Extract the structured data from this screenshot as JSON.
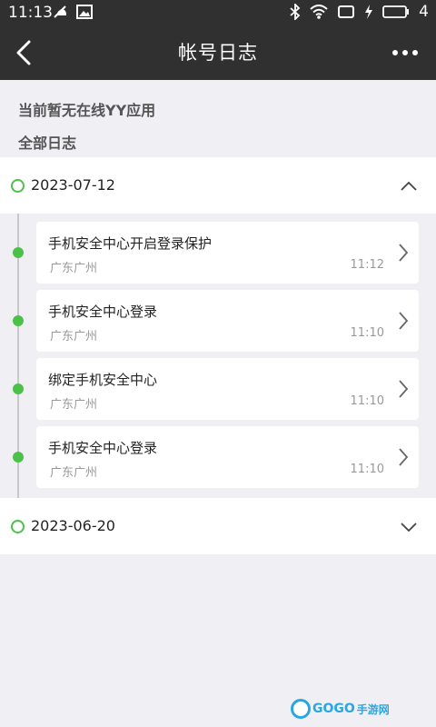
{
  "status_bar": {
    "time": "11:13",
    "battery_level": "4",
    "icons": [
      "silent-notification-icon",
      "image-notification-icon",
      "bluetooth-icon",
      "wifi-icon",
      "cast-icon",
      "charging-icon",
      "battery-icon"
    ]
  },
  "header": {
    "title": "帐号日志"
  },
  "notice": "当前暂无在线YY应用",
  "section_label": "全部日志",
  "groups": [
    {
      "date": "2023-07-12",
      "expanded": true,
      "items": [
        {
          "title": "手机安全中心开启登录保护",
          "location": "广东广州",
          "time": "11:12"
        },
        {
          "title": "手机安全中心登录",
          "location": "广东广州",
          "time": "11:10"
        },
        {
          "title": "绑定手机安全中心",
          "location": "广东广州",
          "time": "11:10"
        },
        {
          "title": "手机安全中心登录",
          "location": "广东广州",
          "time": "11:10"
        }
      ]
    },
    {
      "date": "2023-06-20",
      "expanded": false,
      "items": []
    }
  ],
  "watermark": {
    "brand": "GOGO",
    "text": "手游网"
  },
  "colors": {
    "header_bg": "#303030",
    "accent_green": "#4cc14a",
    "page_bg": "#efeff4"
  }
}
